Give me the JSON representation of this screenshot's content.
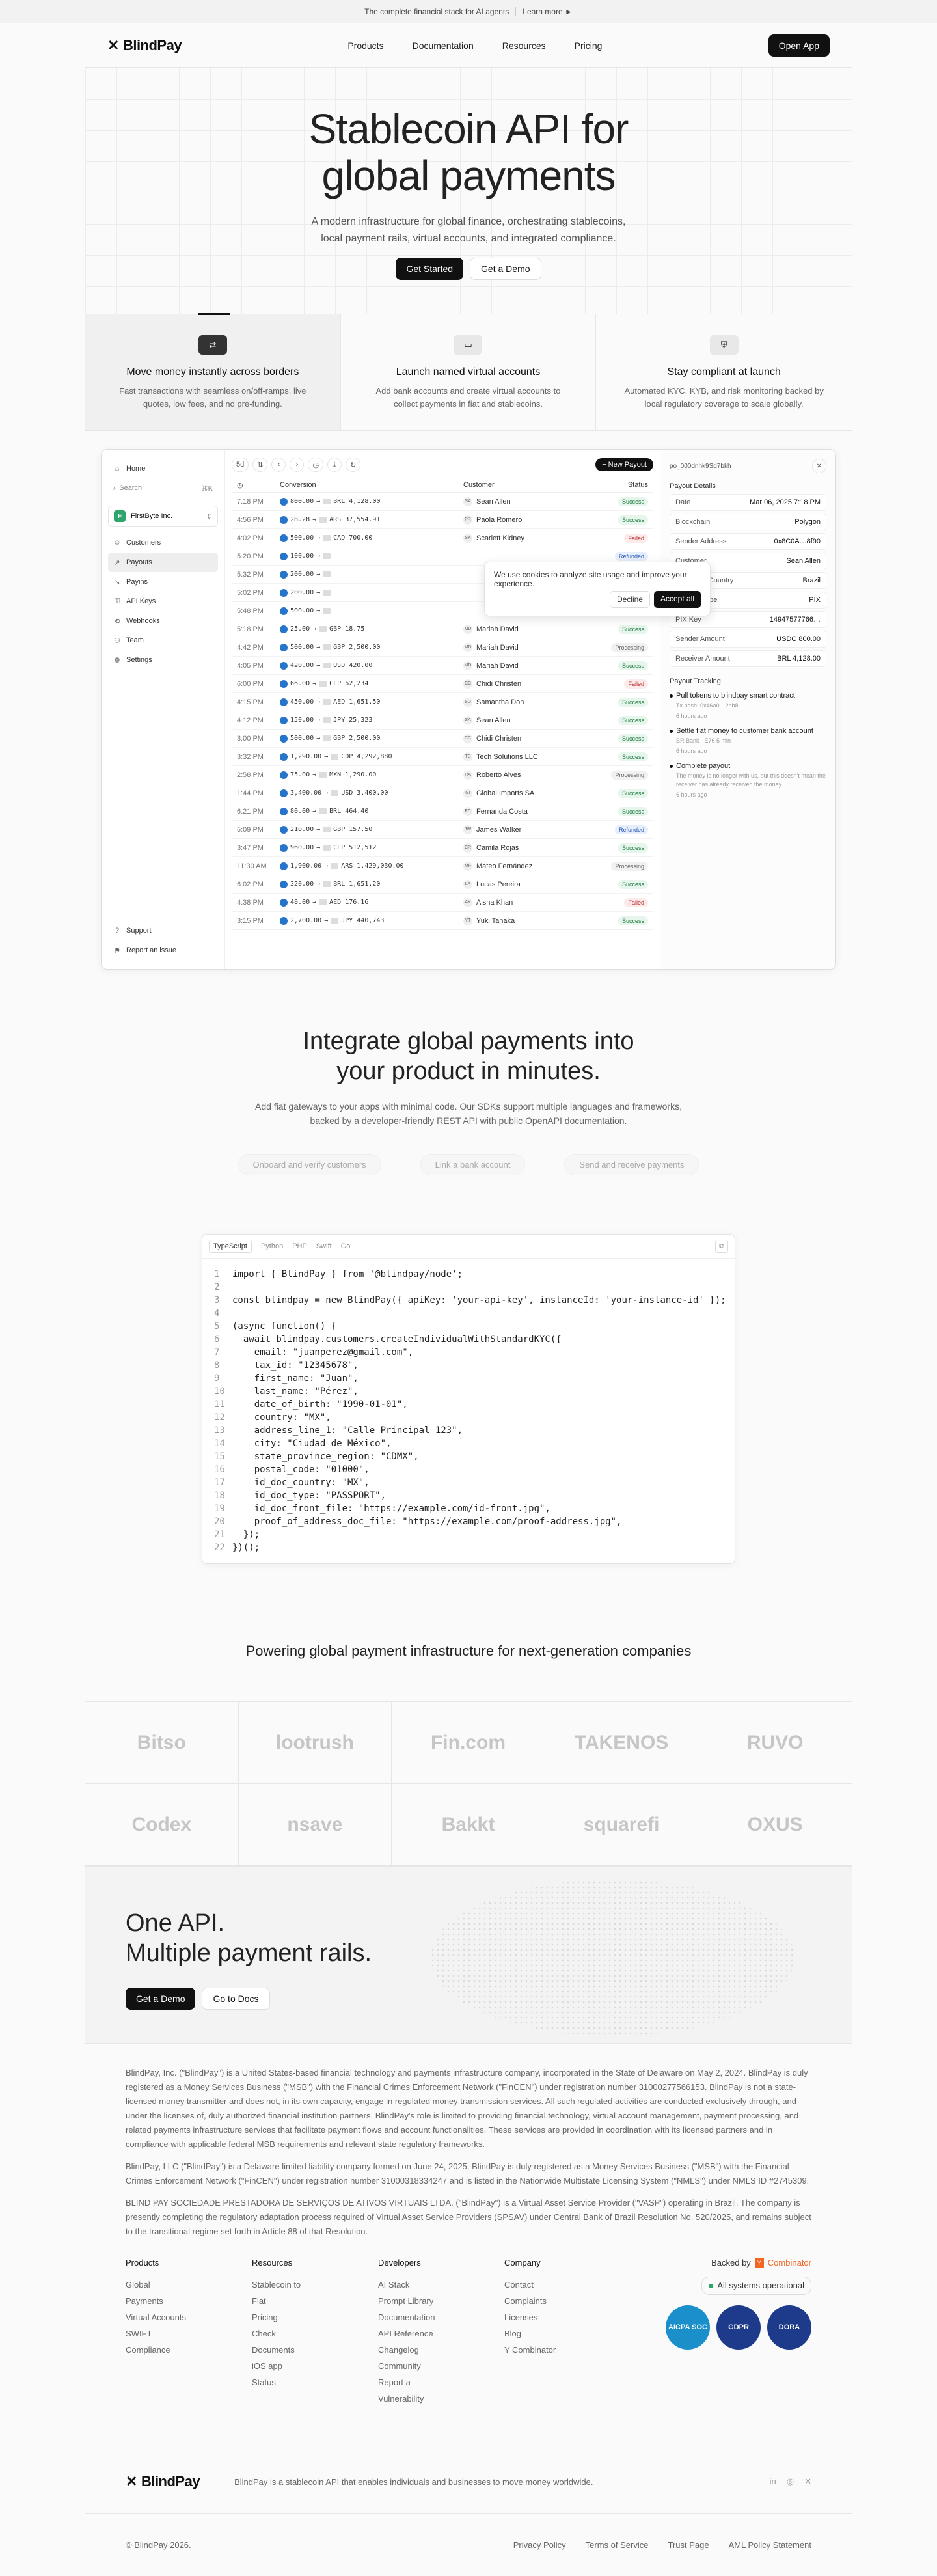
{
  "topbar": {
    "text": "The complete financial stack for AI agents",
    "link": "Learn more ►"
  },
  "nav": {
    "brand": "BlindPay",
    "links": [
      "Products",
      "Documentation",
      "Resources",
      "Pricing"
    ],
    "cta": "Open App"
  },
  "hero": {
    "title_l1": "Stablecoin API for",
    "title_l2": "global payments",
    "sub_l1": "A modern infrastructure for global finance, orchestrating stablecoins,",
    "sub_l2": "local payment rails, virtual accounts, and integrated compliance.",
    "cta_primary": "Get Started",
    "cta_secondary": "Get a Demo"
  },
  "features": [
    {
      "title": "Move money instantly across borders",
      "desc": "Fast transactions with seamless on/off-ramps, live quotes, low fees, and no pre-funding."
    },
    {
      "title": "Launch named virtual accounts",
      "desc": "Add bank accounts and create virtual accounts to collect payments in fiat and stablecoins."
    },
    {
      "title": "Stay compliant at launch",
      "desc": "Automated KYC, KYB, and risk monitoring backed by local regulatory coverage to scale globally."
    }
  ],
  "dashboard": {
    "sidebar": {
      "home": "Home",
      "search": "Search",
      "shortcut": "⌘K",
      "org": "FirstByte Inc.",
      "org_initial": "F",
      "items": [
        "Customers",
        "Payouts",
        "Payins",
        "API Keys",
        "Webhooks",
        "Team",
        "Settings"
      ],
      "support": "Support",
      "report": "Report an issue"
    },
    "toolbar": {
      "filter": "5d",
      "new_payout": "+ New Payout"
    },
    "columns": {
      "conversion": "Conversion",
      "customer": "Customer",
      "status": "Status"
    },
    "rows": [
      {
        "time": "7:18 PM",
        "from": "800.00",
        "to": "BRL 4,128.00",
        "customer": "Sean Allen",
        "status": "Success"
      },
      {
        "time": "4:56 PM",
        "from": "28.28",
        "to": "ARS 37,554.91",
        "customer": "Paola Romero",
        "status": "Success"
      },
      {
        "time": "4:02 PM",
        "from": "500.00",
        "to": "CAD 700.00",
        "customer": "Scarlett Kidney",
        "status": "Failed"
      },
      {
        "time": "5:20 PM",
        "from": "100.00",
        "to": "",
        "customer": "",
        "status": "Refunded"
      },
      {
        "time": "5:32 PM",
        "from": "200.00",
        "to": "",
        "customer": "",
        "status": "Processing"
      },
      {
        "time": "5:02 PM",
        "from": "200.00",
        "to": "",
        "customer": "",
        "status": "Success"
      },
      {
        "time": "5:48 PM",
        "from": "500.00",
        "to": "",
        "customer": "",
        "status": "Refunded"
      },
      {
        "time": "5:18 PM",
        "from": "25.00",
        "to": "GBP 18.75",
        "customer": "Mariah David",
        "status": "Success"
      },
      {
        "time": "4:42 PM",
        "from": "500.00",
        "to": "GBP 2,500.00",
        "customer": "Mariah David",
        "status": "Processing"
      },
      {
        "time": "4:05 PM",
        "from": "420.00",
        "to": "USD 420.00",
        "customer": "Mariah David",
        "status": "Success"
      },
      {
        "time": "6:00 PM",
        "from": "66.00",
        "to": "CLP 62,234",
        "customer": "Chidi Christen",
        "status": "Failed"
      },
      {
        "time": "4:15 PM",
        "from": "450.00",
        "to": "AED 1,651.50",
        "customer": "Samantha Don",
        "status": "Success"
      },
      {
        "time": "4:12 PM",
        "from": "150.00",
        "to": "JPY 25,323",
        "customer": "Sean Allen",
        "status": "Success"
      },
      {
        "time": "3:00 PM",
        "from": "500.00",
        "to": "GBP 2,500.00",
        "customer": "Chidi Christen",
        "status": "Success"
      },
      {
        "time": "3:32 PM",
        "from": "1,290.00",
        "to": "COP 4,292,880",
        "customer": "Tech Solutions LLC",
        "status": "Success"
      },
      {
        "time": "2:58 PM",
        "from": "75.00",
        "to": "MXN 1,290.00",
        "customer": "Roberto Alves",
        "status": "Processing"
      },
      {
        "time": "1:44 PM",
        "from": "3,400.00",
        "to": "USD 3,400.00",
        "customer": "Global Imports SA",
        "status": "Success"
      },
      {
        "time": "6:21 PM",
        "from": "80.00",
        "to": "BRL 464.40",
        "customer": "Fernanda Costa",
        "status": "Success"
      },
      {
        "time": "5:09 PM",
        "from": "210.00",
        "to": "GBP 157.50",
        "customer": "James Walker",
        "status": "Refunded"
      },
      {
        "time": "3:47 PM",
        "from": "960.00",
        "to": "CLP 512,512",
        "customer": "Camila Rojas",
        "status": "Success"
      },
      {
        "time": "11:30 AM",
        "from": "1,900.00",
        "to": "ARS 1,429,030.00",
        "customer": "Mateo Fernández",
        "status": "Processing"
      },
      {
        "time": "6:02 PM",
        "from": "320.00",
        "to": "BRL 1,651.20",
        "customer": "Lucas Pereira",
        "status": "Success"
      },
      {
        "time": "4:38 PM",
        "from": "48.00",
        "to": "AED 176.16",
        "customer": "Aisha Khan",
        "status": "Failed"
      },
      {
        "time": "3:15 PM",
        "from": "2,700.00",
        "to": "JPY 440,743",
        "customer": "Yuki Tanaka",
        "status": "Success"
      }
    ],
    "cookie": {
      "text": "We use cookies to analyze site usage and improve your experience.",
      "decline": "Decline",
      "accept": "Accept all"
    },
    "details": {
      "id": "po_000dnhk9Sd7bkh",
      "title": "Payout Details",
      "fields": [
        [
          "Date",
          "Mar 06, 2025 7:18 PM"
        ],
        [
          "Blockchain",
          "Polygon"
        ],
        [
          "Sender Address",
          "0x8C0A…8f90"
        ],
        [
          "Customer",
          "Sean Allen"
        ],
        [
          "Customer Country",
          "Brazil"
        ],
        [
          "Transfer type",
          "PIX"
        ],
        [
          "PIX Key",
          "14947577766…"
        ],
        [
          "Sender Amount",
          "USDC 800.00"
        ],
        [
          "Receiver Amount",
          "BRL 4,128.00"
        ]
      ],
      "tracking_title": "Payout Tracking",
      "steps": [
        {
          "title": "Pull tokens to blindpay smart contract",
          "sub": "Tx hash: 0x46a0…2bb8",
          "time": "6 hours ago"
        },
        {
          "title": "Settle fiat money to customer bank account",
          "sub": "BR Bank · E76 5 min",
          "time": "6 hours ago"
        },
        {
          "title": "Complete payout",
          "sub": "The money is no longer with us, but this doesn't mean the receiver has already received the money.",
          "time": "6 hours ago"
        }
      ]
    }
  },
  "integrate": {
    "title_l1": "Integrate global payments into",
    "title_l2": "your product in minutes.",
    "sub_l1": "Add fiat gateways to your apps with minimal code. Our SDKs support multiple languages and frameworks,",
    "sub_l2": "backed by a developer-friendly REST API with public OpenAPI documentation.",
    "steps": [
      "Onboard and verify customers",
      "Link a bank account",
      "Send and receive payments"
    ],
    "tabs": [
      "TypeScript",
      "Python",
      "PHP",
      "Swift",
      "Go"
    ]
  },
  "code_lines": [
    "import { BlindPay } from '@blindpay/node';",
    "",
    "const blindpay = new BlindPay({ apiKey: 'your-api-key', instanceId: 'your-instance-id' });",
    "",
    "(async function() {",
    "  await blindpay.customers.createIndividualWithStandardKYC({",
    "    email: \"juanperez@gmail.com\",",
    "    tax_id: \"12345678\",",
    "    first_name: \"Juan\",",
    "    last_name: \"Pérez\",",
    "    date_of_birth: \"1990-01-01\",",
    "    country: \"MX\",",
    "    address_line_1: \"Calle Principal 123\",",
    "    city: \"Ciudad de México\",",
    "    state_province_region: \"CDMX\",",
    "    postal_code: \"01000\",",
    "    id_doc_country: \"MX\",",
    "    id_doc_type: \"PASSPORT\",",
    "    id_doc_front_file: \"https://example.com/id-front.jpg\",",
    "    proof_of_address_doc_file: \"https://example.com/proof-address.jpg\",",
    "  });",
    "})();"
  ],
  "partners": {
    "title": "Powering global payment infrastructure for next-generation companies",
    "logos": [
      "Bitso",
      "lootrush",
      "Fin.com",
      "TAKENOS",
      "RUVO",
      "Codex",
      "nsave",
      "Bakkt",
      "squarefi",
      "OXUS"
    ]
  },
  "oneapi": {
    "title_l1": "One API.",
    "title_l2": "Multiple payment rails.",
    "cta_primary": "Get a Demo",
    "cta_secondary": "Go to Docs"
  },
  "legal": [
    "BlindPay, Inc. (\"BlindPay\") is a United States-based financial technology and payments infrastructure company, incorporated in the State of Delaware on May 2, 2024. BlindPay is duly registered as a Money Services Business (\"MSB\") with the Financial Crimes Enforcement Network (\"FinCEN\") under registration number 31000277566153. BlindPay is not a state-licensed money transmitter and does not, in its own capacity, engage in regulated money transmission services. All such regulated activities are conducted exclusively through, and under the licenses of, duly authorized financial institution partners. BlindPay's role is limited to providing financial technology, virtual account management, payment processing, and related payments infrastructure services that facilitate payment flows and account functionalities. These services are provided in coordination with its licensed partners and in compliance with applicable federal MSB requirements and relevant state regulatory frameworks.",
    "BlindPay, LLC (\"BlindPay\") is a Delaware limited liability company formed on June 24, 2025. BlindPay is duly registered as a Money Services Business (\"MSB\") with the Financial Crimes Enforcement Network (\"FinCEN\") under registration number 31000318334247 and is listed in the Nationwide Multistate Licensing System (\"NMLS\") under NMLS ID #2745309.",
    "BLIND PAY SOCIEDADE PRESTADORA DE SERVIÇOS DE ATIVOS VIRTUAIS LTDA. (\"BlindPay\") is a Virtual Asset Service Provider (\"VASP\") operating in Brazil. The company is presently completing the regulatory adaptation process required of Virtual Asset Service Providers (SPSAV) under Central Bank of Brazil Resolution No. 520/2025, and remains subject to the transitional regime set forth in Article 88 of that Resolution."
  ],
  "footer_cols": [
    {
      "title": "Products",
      "items": [
        "Global Payments",
        "Virtual Accounts",
        "SWIFT",
        "Compliance"
      ]
    },
    {
      "title": "Resources",
      "items": [
        "Stablecoin to Fiat",
        "Pricing",
        "Check Documents",
        "iOS app",
        "Status"
      ]
    },
    {
      "title": "Developers",
      "items": [
        "AI Stack",
        "Prompt Library",
        "Documentation",
        "API Reference",
        "Changelog",
        "Community",
        "Report a Vulnerability"
      ]
    },
    {
      "title": "Company",
      "items": [
        "Contact",
        "Complaints",
        "Licenses",
        "Blog",
        "Y Combinator"
      ]
    }
  ],
  "footer_right": {
    "backed": "Backed by",
    "yc": "Combinator",
    "status": "All systems operational",
    "badges": [
      "AICPA SOC",
      "GDPR",
      "DORA"
    ]
  },
  "footer": {
    "tagline": "BlindPay is a stablecoin API that enables individuals and businesses to move money worldwide.",
    "copyright": "© BlindPay 2026.",
    "links": [
      "Privacy Policy",
      "Terms of Service",
      "Trust Page",
      "AML Policy Statement"
    ]
  },
  "colors": {
    "success": "#1c7a3e",
    "failed": "#b42b2b",
    "refunded": "#2b55b5",
    "accent": "#111111",
    "yc": "#f26522"
  }
}
